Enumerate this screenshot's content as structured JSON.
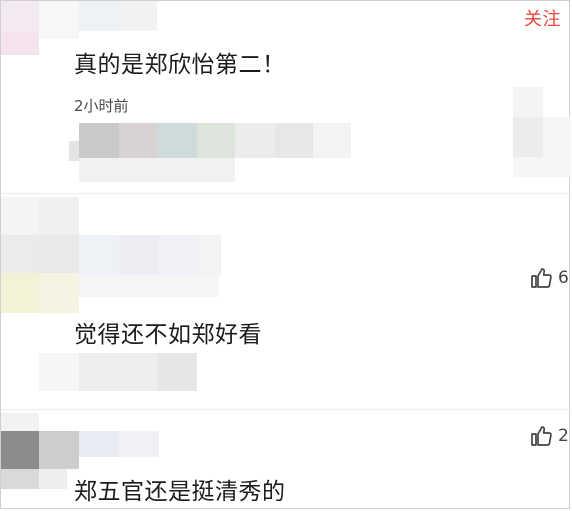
{
  "header": {
    "follow_label": "关注"
  },
  "comments": [
    {
      "text": "真的是郑欣怡第二！",
      "time": "2小时前"
    },
    {
      "text": "觉得还不如郑好看",
      "likes": "6"
    },
    {
      "text": "郑五官还是挺清秀的",
      "likes": "2"
    }
  ],
  "icons": {
    "like": "thumbs-up-icon"
  },
  "colors": {
    "accent": "#e8483c",
    "text": "#1c1c1c",
    "meta": "#4a4a4a"
  }
}
